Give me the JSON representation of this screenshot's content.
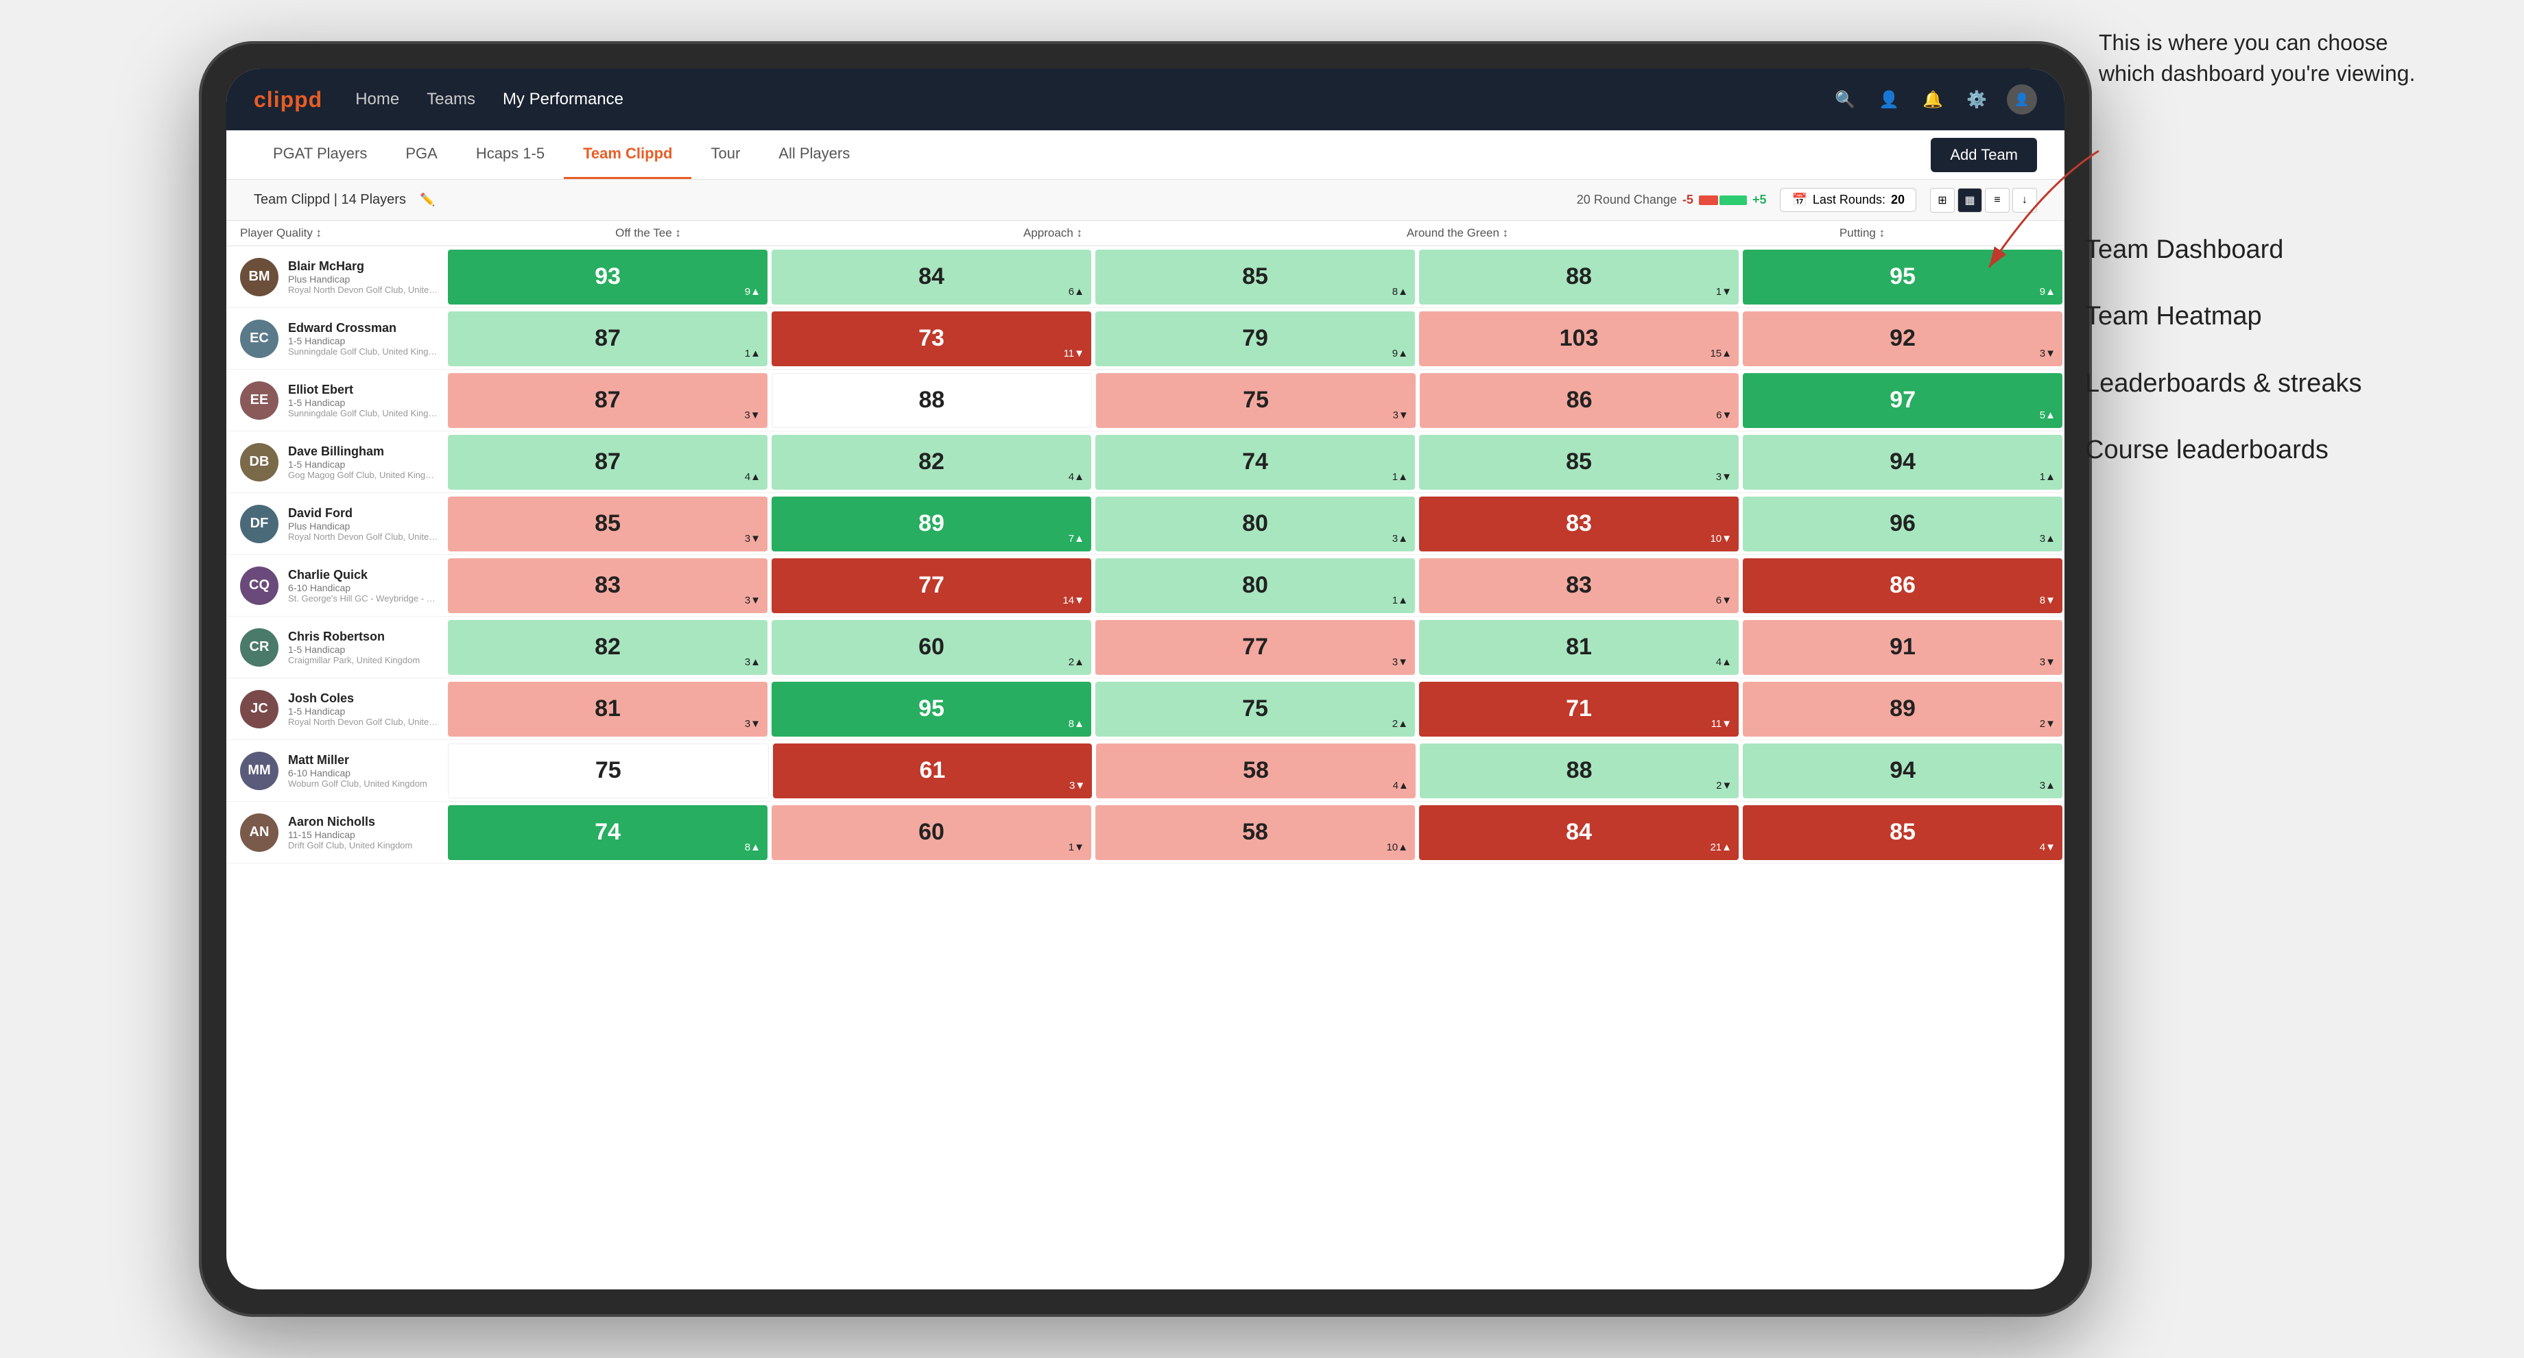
{
  "annotation": {
    "text": "This is where you can choose which dashboard you're viewing.",
    "items": [
      "Team Dashboard",
      "Team Heatmap",
      "Leaderboards & streaks",
      "Course leaderboards"
    ]
  },
  "nav": {
    "logo": "clippd",
    "links": [
      "Home",
      "Teams",
      "My Performance"
    ],
    "active_link": "My Performance"
  },
  "subnav": {
    "links": [
      "PGAT Players",
      "PGA",
      "Hcaps 1-5",
      "Team Clippd",
      "Tour",
      "All Players"
    ],
    "active": "Team Clippd",
    "add_btn": "Add Team"
  },
  "team_header": {
    "name": "Team Clippd | 14 Players",
    "round_change_label": "20 Round Change",
    "neg": "-5",
    "pos": "+5",
    "last_rounds_label": "Last Rounds:",
    "last_rounds_val": "20"
  },
  "table": {
    "columns": [
      "Player Quality ↕",
      "Off the Tee ↕",
      "Approach ↕",
      "Around the Green ↕",
      "Putting ↕"
    ],
    "players": [
      {
        "name": "Blair McHarg",
        "hcap": "Plus Handicap",
        "club": "Royal North Devon Golf Club, United Kingdom",
        "initials": "BM",
        "color": "#6b4f3a",
        "stats": [
          {
            "val": "93",
            "sub": "9▲",
            "color": "green-dark"
          },
          {
            "val": "84",
            "sub": "6▲",
            "color": "green-light"
          },
          {
            "val": "85",
            "sub": "8▲",
            "color": "green-light"
          },
          {
            "val": "88",
            "sub": "1▼",
            "color": "green-light"
          },
          {
            "val": "95",
            "sub": "9▲",
            "color": "green-dark"
          }
        ]
      },
      {
        "name": "Edward Crossman",
        "hcap": "1-5 Handicap",
        "club": "Sunningdale Golf Club, United Kingdom",
        "initials": "EC",
        "color": "#5a7a8a",
        "stats": [
          {
            "val": "87",
            "sub": "1▲",
            "color": "green-light"
          },
          {
            "val": "73",
            "sub": "11▼",
            "color": "red-dark"
          },
          {
            "val": "79",
            "sub": "9▲",
            "color": "green-light"
          },
          {
            "val": "103",
            "sub": "15▲",
            "color": "red-light"
          },
          {
            "val": "92",
            "sub": "3▼",
            "color": "red-light"
          }
        ]
      },
      {
        "name": "Elliot Ebert",
        "hcap": "1-5 Handicap",
        "club": "Sunningdale Golf Club, United Kingdom",
        "initials": "EE",
        "color": "#8a5a5a",
        "stats": [
          {
            "val": "87",
            "sub": "3▼",
            "color": "red-light"
          },
          {
            "val": "88",
            "sub": "",
            "color": "white-cell"
          },
          {
            "val": "75",
            "sub": "3▼",
            "color": "red-light"
          },
          {
            "val": "86",
            "sub": "6▼",
            "color": "red-light"
          },
          {
            "val": "97",
            "sub": "5▲",
            "color": "green-dark"
          }
        ]
      },
      {
        "name": "Dave Billingham",
        "hcap": "1-5 Handicap",
        "club": "Gog Magog Golf Club, United Kingdom",
        "initials": "DB",
        "color": "#7a6a4a",
        "stats": [
          {
            "val": "87",
            "sub": "4▲",
            "color": "green-light"
          },
          {
            "val": "82",
            "sub": "4▲",
            "color": "green-light"
          },
          {
            "val": "74",
            "sub": "1▲",
            "color": "green-light"
          },
          {
            "val": "85",
            "sub": "3▼",
            "color": "green-light"
          },
          {
            "val": "94",
            "sub": "1▲",
            "color": "green-light"
          }
        ]
      },
      {
        "name": "David Ford",
        "hcap": "Plus Handicap",
        "club": "Royal North Devon Golf Club, United Kingdom",
        "initials": "DF",
        "color": "#4a6a7a",
        "stats": [
          {
            "val": "85",
            "sub": "3▼",
            "color": "red-light"
          },
          {
            "val": "89",
            "sub": "7▲",
            "color": "green-dark"
          },
          {
            "val": "80",
            "sub": "3▲",
            "color": "green-light"
          },
          {
            "val": "83",
            "sub": "10▼",
            "color": "red-dark"
          },
          {
            "val": "96",
            "sub": "3▲",
            "color": "green-light"
          }
        ]
      },
      {
        "name": "Charlie Quick",
        "hcap": "6-10 Handicap",
        "club": "St. George's Hill GC - Weybridge - Surrey, Uni...",
        "initials": "CQ",
        "color": "#6a4a7a",
        "stats": [
          {
            "val": "83",
            "sub": "3▼",
            "color": "red-light"
          },
          {
            "val": "77",
            "sub": "14▼",
            "color": "red-dark"
          },
          {
            "val": "80",
            "sub": "1▲",
            "color": "green-light"
          },
          {
            "val": "83",
            "sub": "6▼",
            "color": "red-light"
          },
          {
            "val": "86",
            "sub": "8▼",
            "color": "red-dark"
          }
        ]
      },
      {
        "name": "Chris Robertson",
        "hcap": "1-5 Handicap",
        "club": "Craigmillar Park, United Kingdom",
        "initials": "CR",
        "color": "#4a7a6a",
        "stats": [
          {
            "val": "82",
            "sub": "3▲",
            "color": "green-light"
          },
          {
            "val": "60",
            "sub": "2▲",
            "color": "green-light"
          },
          {
            "val": "77",
            "sub": "3▼",
            "color": "red-light"
          },
          {
            "val": "81",
            "sub": "4▲",
            "color": "green-light"
          },
          {
            "val": "91",
            "sub": "3▼",
            "color": "red-light"
          }
        ]
      },
      {
        "name": "Josh Coles",
        "hcap": "1-5 Handicap",
        "club": "Royal North Devon Golf Club, United Kingdom",
        "initials": "JC",
        "color": "#7a4a4a",
        "stats": [
          {
            "val": "81",
            "sub": "3▼",
            "color": "red-light"
          },
          {
            "val": "95",
            "sub": "8▲",
            "color": "green-dark"
          },
          {
            "val": "75",
            "sub": "2▲",
            "color": "green-light"
          },
          {
            "val": "71",
            "sub": "11▼",
            "color": "red-dark"
          },
          {
            "val": "89",
            "sub": "2▼",
            "color": "red-light"
          }
        ]
      },
      {
        "name": "Matt Miller",
        "hcap": "6-10 Handicap",
        "club": "Woburn Golf Club, United Kingdom",
        "initials": "MM",
        "color": "#5a5a7a",
        "stats": [
          {
            "val": "75",
            "sub": "",
            "color": "white-cell"
          },
          {
            "val": "61",
            "sub": "3▼",
            "color": "red-dark"
          },
          {
            "val": "58",
            "sub": "4▲",
            "color": "red-light"
          },
          {
            "val": "88",
            "sub": "2▼",
            "color": "green-light"
          },
          {
            "val": "94",
            "sub": "3▲",
            "color": "green-light"
          }
        ]
      },
      {
        "name": "Aaron Nicholls",
        "hcap": "11-15 Handicap",
        "club": "Drift Golf Club, United Kingdom",
        "initials": "AN",
        "color": "#7a5a4a",
        "stats": [
          {
            "val": "74",
            "sub": "8▲",
            "color": "green-dark"
          },
          {
            "val": "60",
            "sub": "1▼",
            "color": "red-light"
          },
          {
            "val": "58",
            "sub": "10▲",
            "color": "red-light"
          },
          {
            "val": "84",
            "sub": "21▲",
            "color": "red-dark"
          },
          {
            "val": "85",
            "sub": "4▼",
            "color": "red-dark"
          }
        ]
      }
    ]
  }
}
